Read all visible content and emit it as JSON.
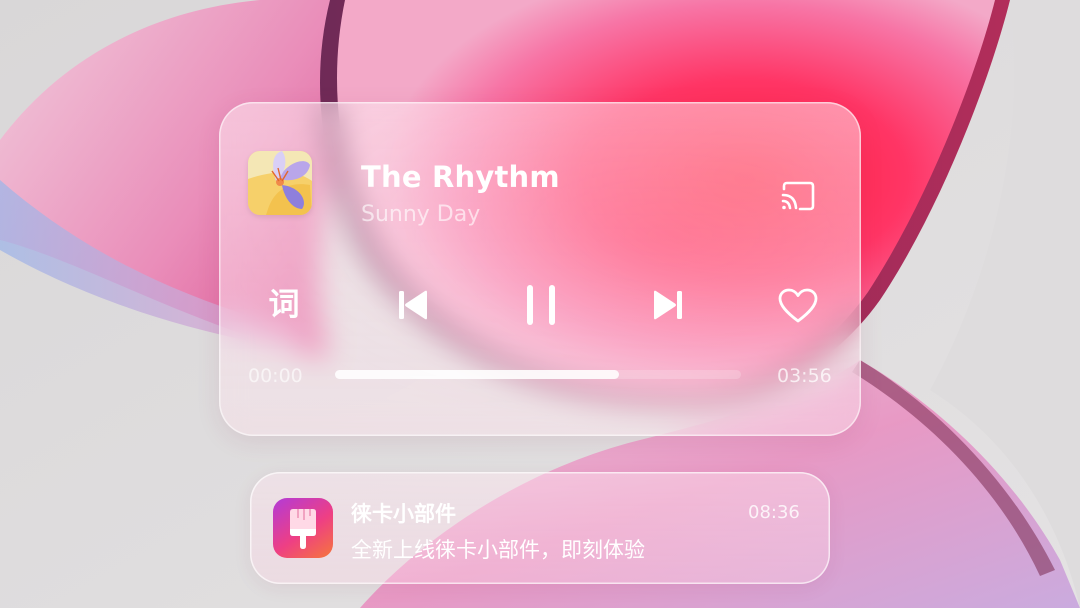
{
  "music_widget": {
    "song_title": "The Rhythm",
    "artist": "Sunny Day",
    "album_art_icon": "flower-album-art",
    "cast_icon": "cast-icon",
    "controls": {
      "lyrics_label": "词",
      "prev_icon": "skip-previous-icon",
      "pause_icon": "pause-icon",
      "next_icon": "skip-next-icon",
      "like_icon": "heart-icon"
    },
    "elapsed_time": "00:00",
    "total_time": "03:56",
    "progress_fraction": 0.7
  },
  "notification": {
    "app_icon": "paintbrush-icon",
    "title": "徕卡小部件",
    "time": "08:36",
    "body": "全新上线徕卡小部件，即刻体验"
  },
  "colors": {
    "accent_red": "#ff2f58",
    "accent_pink": "#f28fb8",
    "text_white": "#ffffff"
  }
}
